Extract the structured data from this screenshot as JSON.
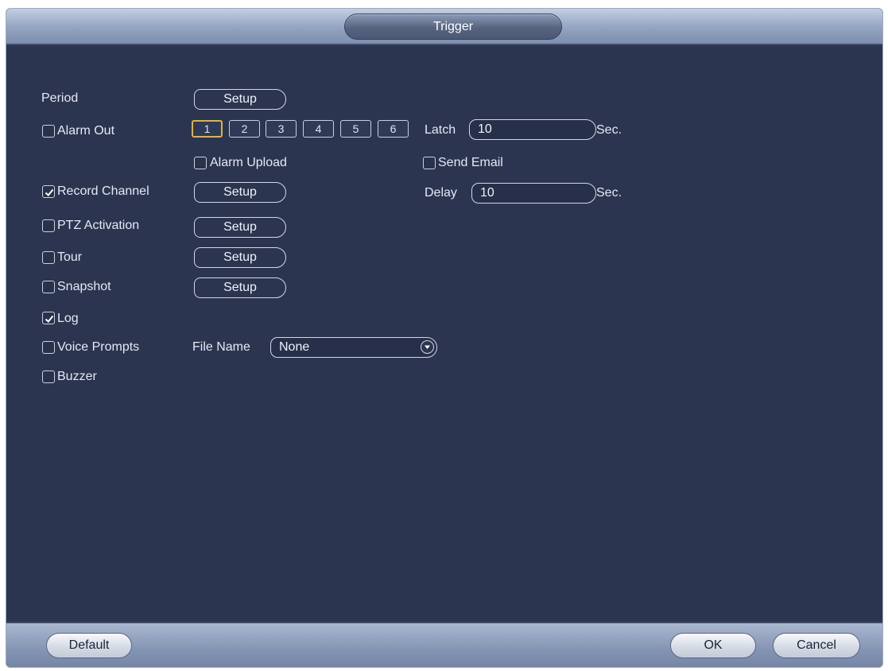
{
  "dialog": {
    "title": "Trigger"
  },
  "period": {
    "label": "Period",
    "button": "Setup"
  },
  "alarm_out": {
    "label": "Alarm Out",
    "checked": false,
    "channels": [
      "1",
      "2",
      "3",
      "4",
      "5",
      "6"
    ],
    "selected_channel": "1",
    "latch_label": "Latch",
    "latch_value": "10",
    "latch_unit": "Sec."
  },
  "alarm_upload": {
    "label": "Alarm Upload",
    "checked": false
  },
  "send_email": {
    "label": "Send Email",
    "checked": false
  },
  "record_channel": {
    "label": "Record Channel",
    "checked": true,
    "button": "Setup",
    "delay_label": "Delay",
    "delay_value": "10",
    "delay_unit": "Sec."
  },
  "ptz_activation": {
    "label": "PTZ Activation",
    "checked": false,
    "button": "Setup"
  },
  "tour": {
    "label": "Tour",
    "checked": false,
    "button": "Setup"
  },
  "snapshot": {
    "label": "Snapshot",
    "checked": false,
    "button": "Setup"
  },
  "log": {
    "label": "Log",
    "checked": true
  },
  "voice_prompts": {
    "label": "Voice Prompts",
    "checked": false,
    "file_name_label": "File Name",
    "file_name_value": "None"
  },
  "buzzer": {
    "label": "Buzzer",
    "checked": false
  },
  "footer": {
    "default_button": "Default",
    "ok_button": "OK",
    "cancel_button": "Cancel"
  }
}
